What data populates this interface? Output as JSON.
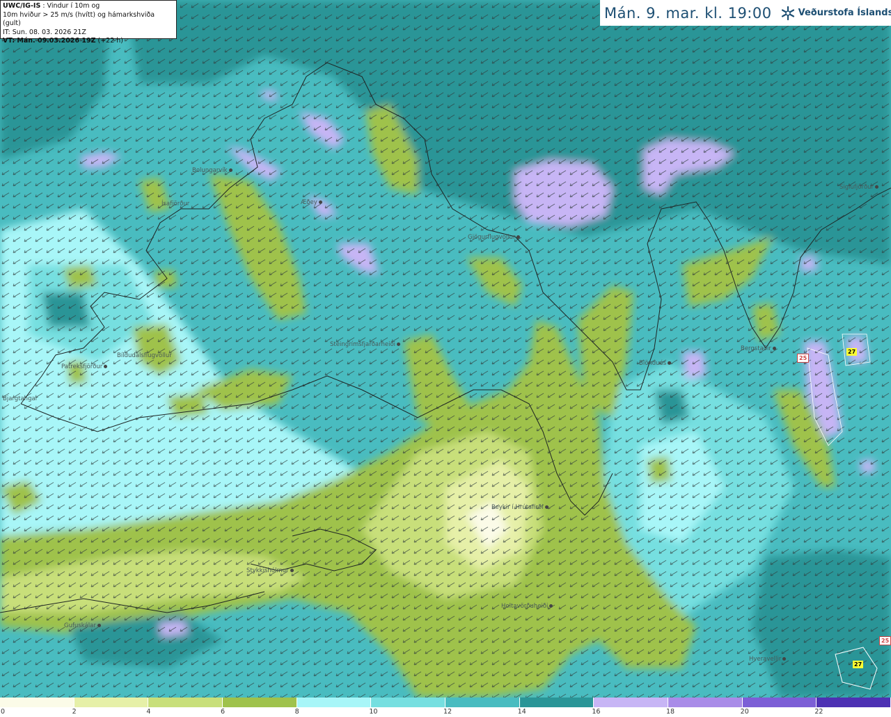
{
  "info": {
    "line1_bold": "UWC/IG-IS",
    "line1_rest": " : Vindur í 10m og",
    "line2": "10m hviður > 25 m/s (hvítt) og hámarkshviða (gult)",
    "line3": "IT: Sun. 08. 03. 2026 21Z",
    "line4_bold": "VT: Mán. 09.03.2026 19Z",
    "line4_rest": " (+22 h)"
  },
  "header": {
    "title": "Mán. 9. mar. kl. 19:00",
    "logo_text": "Veðurstofa Íslands",
    "logo_icon": "snowflake-logo-icon"
  },
  "legend": {
    "ticks": [
      "0",
      "2",
      "4",
      "6",
      "8",
      "10",
      "12",
      "14",
      "16",
      "18",
      "20",
      "22"
    ],
    "colors": [
      "#fbfbe8",
      "#e6f0a8",
      "#c8df7a",
      "#9fc24c",
      "#a8f6f8",
      "#76dfe0",
      "#49bcc0",
      "#2a9597",
      "#c7b5f5",
      "#a98ce8",
      "#7c5fd6",
      "#4d31b3"
    ]
  },
  "places": [
    {
      "name": "Bolungarvík",
      "dot": "right"
    },
    {
      "name": "Ísafjörður",
      "dot": "none"
    },
    {
      "name": "Æðey",
      "dot": "right"
    },
    {
      "name": "Gjögurflugvöllur",
      "dot": "right"
    },
    {
      "name": "Siglufjörður",
      "dot": "right"
    },
    {
      "name": "Patreksfjörður",
      "dot": "right"
    },
    {
      "name": "Bíldudalsflugvöllur",
      "dot": "left"
    },
    {
      "name": "Bjargtangar",
      "dot": "left"
    },
    {
      "name": "Steingrímsfjarðarheiði",
      "dot": "right"
    },
    {
      "name": "Blönduós",
      "dot": "right"
    },
    {
      "name": "Bergstaðir",
      "dot": "right"
    },
    {
      "name": "Reykir í Hrútafirði",
      "dot": "right"
    },
    {
      "name": "Stykkishólmur",
      "dot": "right"
    },
    {
      "name": "Holtavörðuheiði",
      "dot": "right"
    },
    {
      "name": "Hveravellir",
      "dot": "right"
    },
    {
      "name": "Gufuskálar",
      "dot": "right"
    }
  ],
  "gusts": [
    {
      "value": "25",
      "kind": "white"
    },
    {
      "value": "27",
      "kind": "yellow"
    },
    {
      "value": "25",
      "kind": "white"
    },
    {
      "value": "27",
      "kind": "yellow"
    }
  ]
}
